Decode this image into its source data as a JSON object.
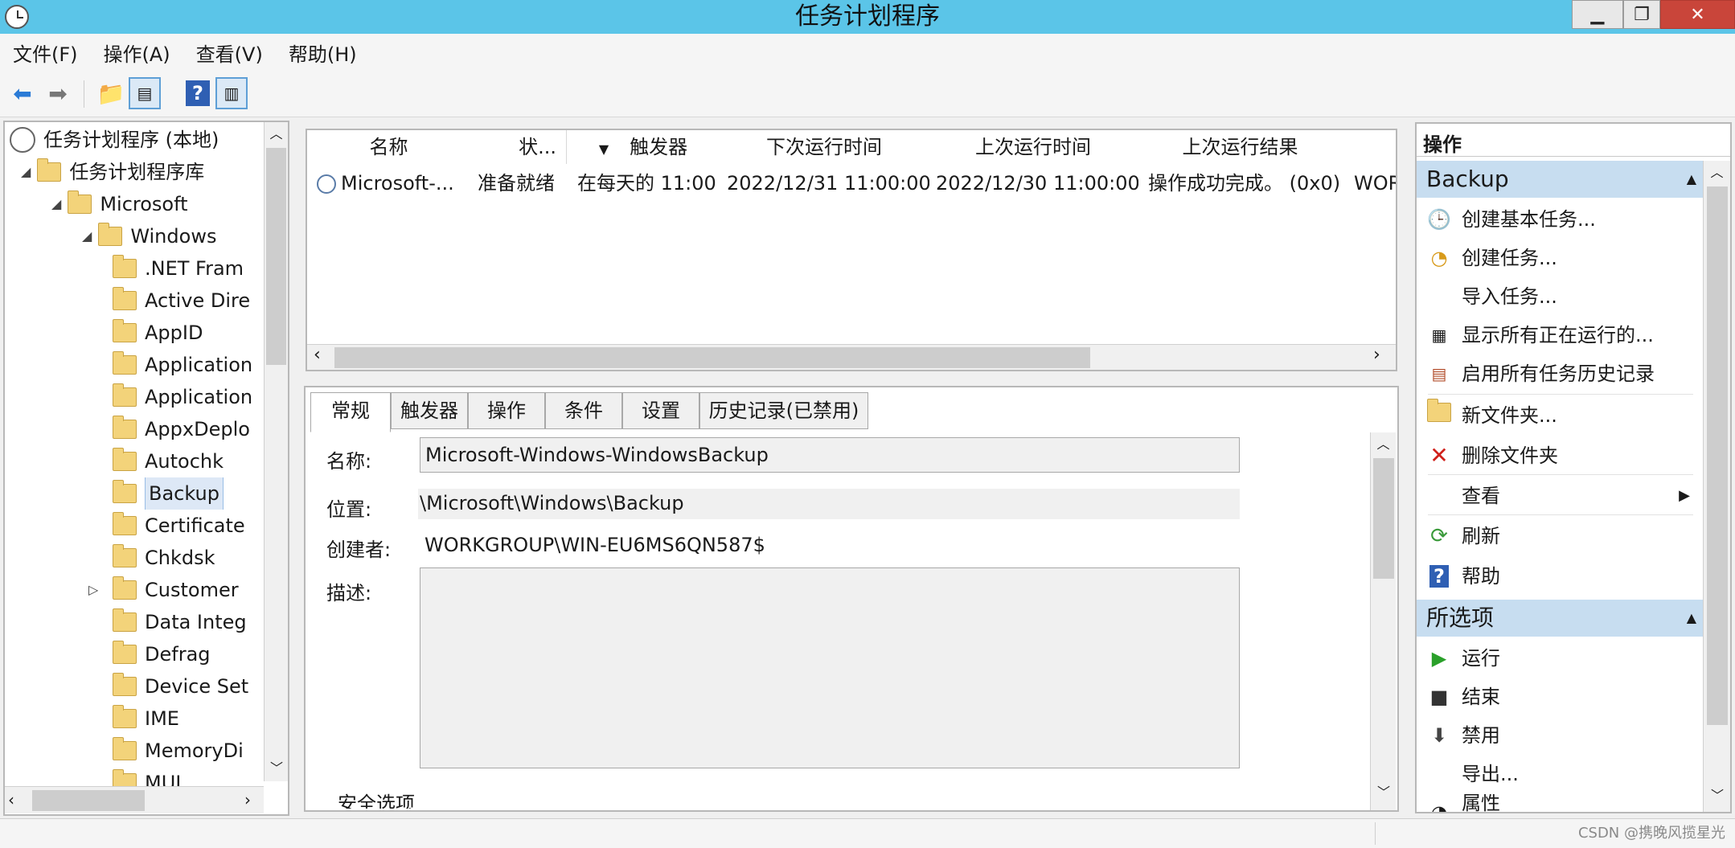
{
  "window": {
    "title": "任务计划程序"
  },
  "menu": [
    "文件(F)",
    "操作(A)",
    "查看(V)",
    "帮助(H)"
  ],
  "tree": {
    "root": "任务计划程序 (本地)",
    "library": "任务计划程序库",
    "microsoft": "Microsoft",
    "windows": "Windows",
    "folders": [
      ".NET Fram",
      "Active Dire",
      "AppID",
      "Application",
      "Application",
      "AppxDeplo",
      "Autochk",
      "Backup",
      "Certificate",
      "Chkdsk",
      "Customer",
      "Data Integ",
      "Defrag",
      "Device Set",
      "IME",
      "MemoryDi",
      "MUI"
    ],
    "selected": "Backup"
  },
  "task_list": {
    "columns": [
      "名称",
      "状...",
      "触发器",
      "下次运行时间",
      "上次运行时间",
      "上次运行结果",
      ""
    ],
    "rows": [
      {
        "name": "Microsoft-...",
        "status": "准备就绪",
        "trigger": "在每天的 11:00",
        "next_run": "2022/12/31 11:00:00",
        "last_run": "2022/12/30 11:00:00",
        "last_result": "操作成功完成。 (0x0)",
        "author": "WOR"
      }
    ]
  },
  "details": {
    "tabs": [
      "常规",
      "触发器",
      "操作",
      "条件",
      "设置",
      "历史记录(已禁用)"
    ],
    "name_label": "名称:",
    "name_value": "Microsoft-Windows-WindowsBackup",
    "location_label": "位置:",
    "location_value": "\\Microsoft\\Windows\\Backup",
    "author_label": "创建者:",
    "author_value": "WORKGROUP\\WIN-EU6MS6QN587$",
    "desc_label": "描述:",
    "security_label": "安全选项"
  },
  "actions": {
    "header": "操作",
    "section1": "Backup",
    "items1": [
      "创建基本任务...",
      "创建任务...",
      "导入任务...",
      "显示所有正在运行的...",
      "启用所有任务历史记录",
      "新文件夹...",
      "删除文件夹",
      "查看",
      "刷新",
      "帮助"
    ],
    "section2": "所选项",
    "items2": [
      "运行",
      "结束",
      "禁用",
      "导出...",
      "属性"
    ]
  },
  "watermark": "CSDN @携晚风揽星光",
  "colors": {
    "titlebar": "#5bc5e8",
    "close": "#c9453a",
    "section_header": "#c7ddf0"
  }
}
